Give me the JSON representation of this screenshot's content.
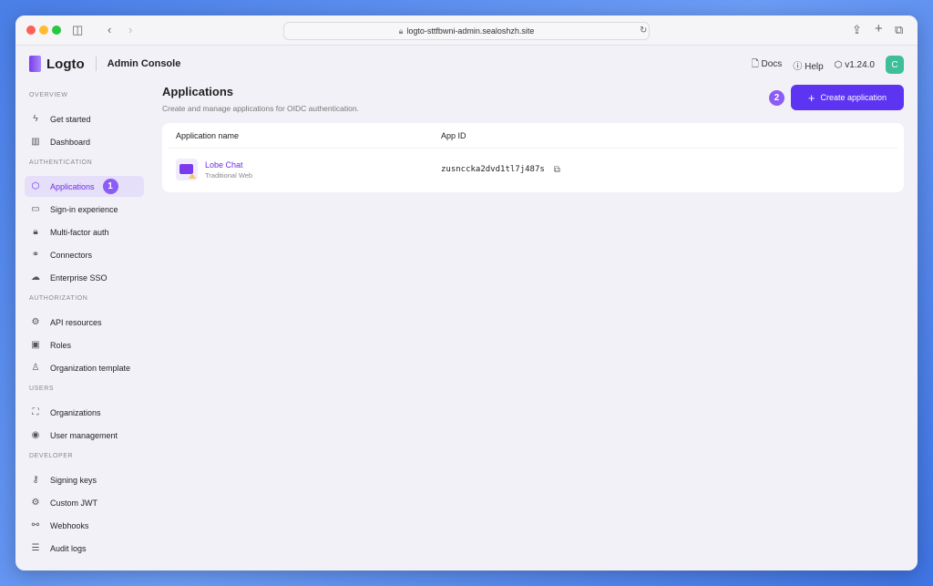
{
  "browser": {
    "url": "logto-sttfbwni-admin.sealoshzh.site"
  },
  "header": {
    "logo": "Logto",
    "console": "Admin Console",
    "docs": "Docs",
    "help": "Help",
    "version": "v1.24.0",
    "avatar": "C"
  },
  "sidebar": {
    "sections": [
      {
        "title": "OVERVIEW",
        "items": [
          {
            "label": "Get started",
            "icon": "ϟ"
          },
          {
            "label": "Dashboard",
            "icon": "▥"
          }
        ]
      },
      {
        "title": "AUTHENTICATION",
        "items": [
          {
            "label": "Applications",
            "icon": "⬡",
            "active": true,
            "badge": "1"
          },
          {
            "label": "Sign-in experience",
            "icon": "▭"
          },
          {
            "label": "Multi-factor auth",
            "icon": "🔒︎"
          },
          {
            "label": "Connectors",
            "icon": "⚭"
          },
          {
            "label": "Enterprise SSO",
            "icon": "☁"
          }
        ]
      },
      {
        "title": "AUTHORIZATION",
        "items": [
          {
            "label": "API resources",
            "icon": "⚙"
          },
          {
            "label": "Roles",
            "icon": "▣"
          },
          {
            "label": "Organization template",
            "icon": "♙"
          }
        ]
      },
      {
        "title": "USERS",
        "items": [
          {
            "label": "Organizations",
            "icon": "⛶"
          },
          {
            "label": "User management",
            "icon": "◉"
          }
        ]
      },
      {
        "title": "DEVELOPER",
        "items": [
          {
            "label": "Signing keys",
            "icon": "⚷"
          },
          {
            "label": "Custom JWT",
            "icon": "⚙"
          },
          {
            "label": "Webhooks",
            "icon": "⚯"
          },
          {
            "label": "Audit logs",
            "icon": "☰"
          }
        ]
      }
    ]
  },
  "main": {
    "title": "Applications",
    "subtitle": "Create and manage applications for OIDC authentication.",
    "step_badge": "2",
    "create_label": "Create application",
    "columns": [
      "Application name",
      "App ID"
    ],
    "rows": [
      {
        "name": "Lobe Chat",
        "type": "Traditional Web",
        "app_id": "zusnccka2dvd1tl7j487s"
      }
    ]
  }
}
